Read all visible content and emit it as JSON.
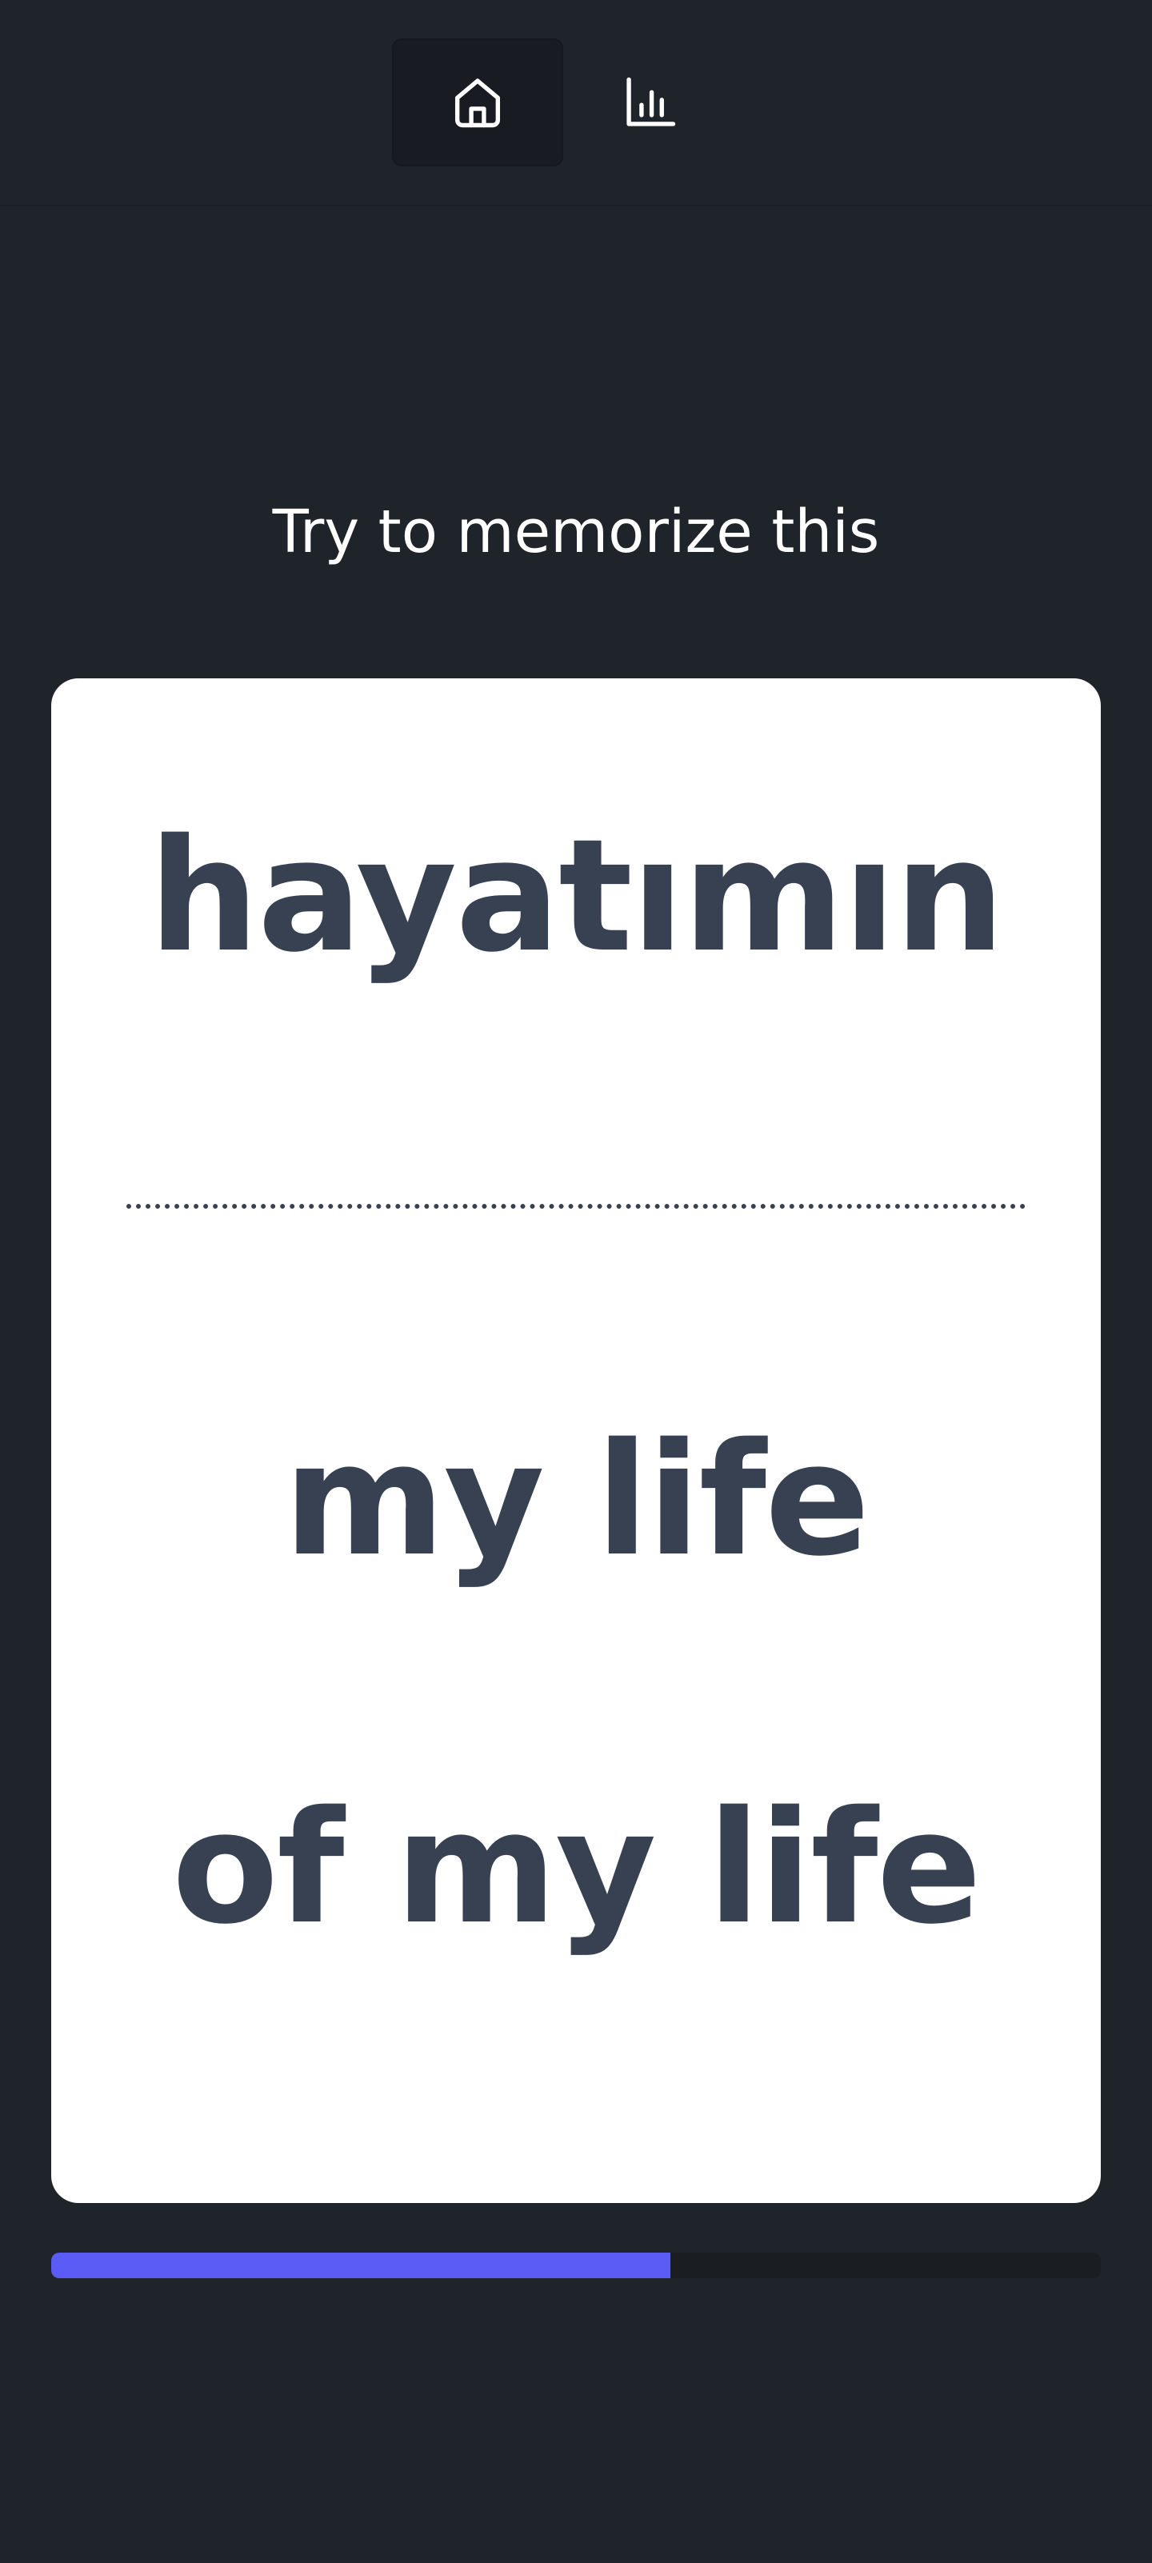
{
  "nav": {
    "items": [
      {
        "id": "home",
        "icon": "home-icon",
        "active": true
      },
      {
        "id": "stats",
        "icon": "bar-chart-icon",
        "active": false
      }
    ]
  },
  "prompt": "Try to memorize this",
  "card": {
    "source": "hayatımın",
    "translations": [
      "my life",
      "of my life"
    ]
  },
  "progress": {
    "value": 0.59
  },
  "colors": {
    "background": "#1f232a",
    "card": "#ffffff",
    "text": "#374151",
    "accent": "#5a5cf5"
  }
}
